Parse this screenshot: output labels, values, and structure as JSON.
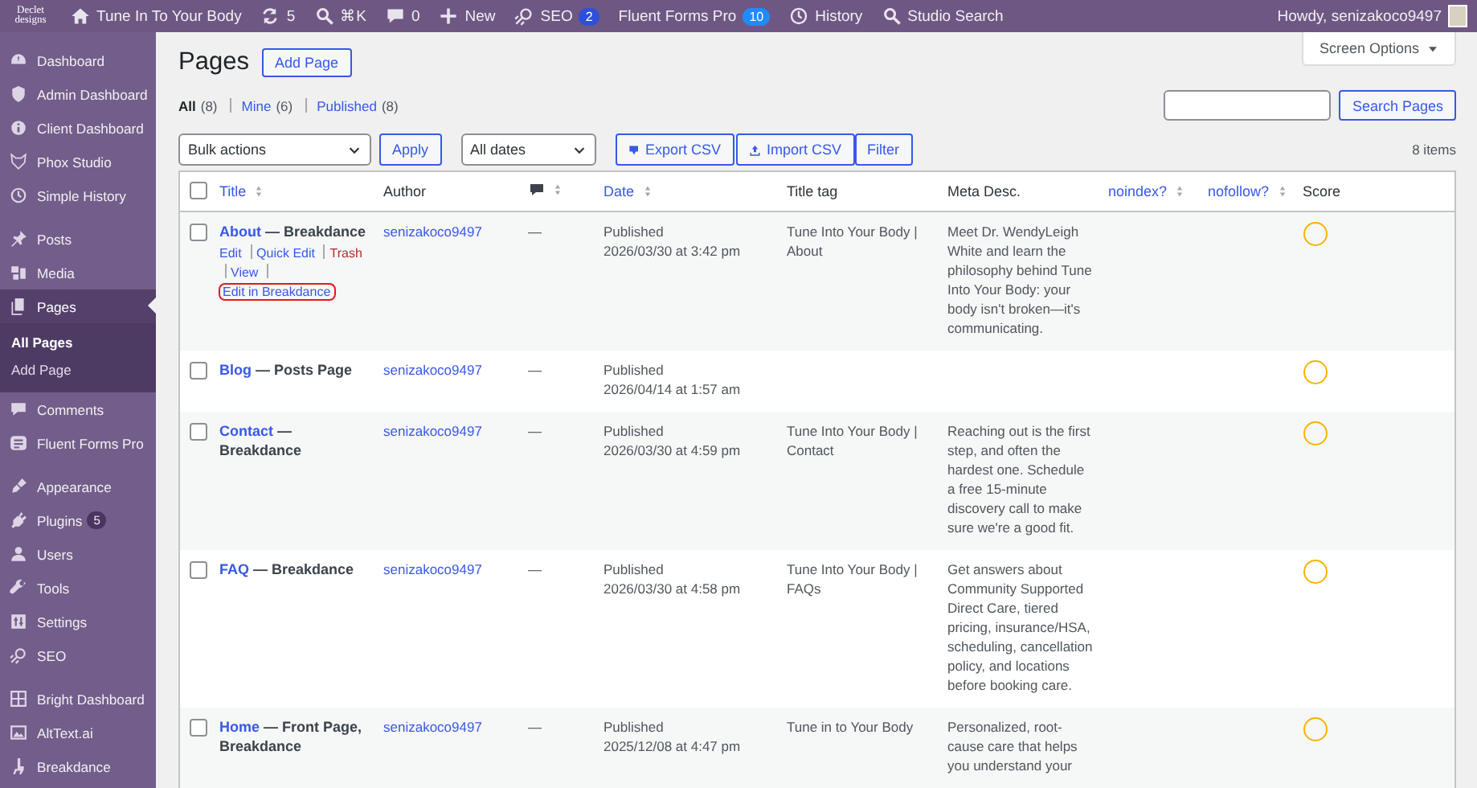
{
  "admin_bar": {
    "logo": [
      "Declet",
      "designs"
    ],
    "items": [
      {
        "kind": "home",
        "label": "Tune In To Your Body"
      },
      {
        "kind": "updates",
        "label": "5"
      },
      {
        "kind": "search",
        "label": "⌘K"
      },
      {
        "kind": "comments",
        "label": "0"
      },
      {
        "kind": "new",
        "label": "New"
      },
      {
        "kind": "seo",
        "label": "SEO",
        "badge": "2",
        "color": "#2f4fd8"
      },
      {
        "kind": "plain",
        "label": "Fluent Forms Pro",
        "badge": "10",
        "color": "#1f8bff"
      },
      {
        "kind": "history",
        "label": "History"
      },
      {
        "kind": "search",
        "label": "Studio Search"
      }
    ],
    "greeting": "Howdy, senizakoco9497"
  },
  "sidebar": {
    "groups": [
      [
        {
          "label": "Dashboard",
          "selected": false
        },
        {
          "label": "Admin Dashboard",
          "selected": false
        },
        {
          "label": "Client Dashboard",
          "selected": false
        },
        {
          "label": "Phox Studio",
          "selected": false
        },
        {
          "label": "Simple History",
          "selected": false
        }
      ],
      [
        {
          "label": "Posts",
          "selected": false
        },
        {
          "label": "Media",
          "selected": false
        },
        {
          "label": "Pages",
          "selected": true,
          "children": [
            {
              "label": "All Pages",
              "selected": true
            },
            {
              "label": "Add Page",
              "selected": false
            }
          ]
        },
        {
          "label": "Comments",
          "selected": false
        },
        {
          "label": "Fluent Forms Pro",
          "selected": false
        }
      ],
      [
        {
          "label": "Appearance",
          "selected": false
        },
        {
          "label": "Plugins",
          "selected": false,
          "badge": "5"
        },
        {
          "label": "Users",
          "selected": false
        },
        {
          "label": "Tools",
          "selected": false
        },
        {
          "label": "Settings",
          "selected": false
        },
        {
          "label": "SEO",
          "selected": false
        }
      ],
      [
        {
          "label": "Bright Dashboard",
          "selected": false
        },
        {
          "label": "AltText.ai",
          "selected": false
        },
        {
          "label": "Breakdance",
          "selected": false
        }
      ]
    ]
  },
  "page": {
    "title": "Pages",
    "add_button": "Add Page",
    "screen_options": "Screen Options",
    "views": [
      {
        "label": "All",
        "count": "(8)",
        "selected": true
      },
      {
        "label": "Mine",
        "count": "(6)",
        "selected": false
      },
      {
        "label": "Published",
        "count": "(8)",
        "selected": false
      }
    ],
    "search_button": "Search Pages",
    "bulk_actions": "Bulk actions",
    "apply": "Apply",
    "dates": "All dates",
    "export": "Export CSV",
    "import": "Import CSV",
    "filter": "Filter",
    "count": "8 items"
  },
  "table": {
    "select_all_checked": false,
    "columns": [
      {
        "kind": "title",
        "label": "Title",
        "link": true,
        "sortable": true
      },
      {
        "kind": "text",
        "label": "Author",
        "link": false,
        "sortable": false
      },
      {
        "kind": "comments",
        "link": false,
        "sortable": true
      },
      {
        "kind": "text",
        "label": "Date",
        "link": true,
        "sortable": true
      },
      {
        "kind": "text",
        "label": "Title tag",
        "link": false,
        "sortable": false
      },
      {
        "kind": "text",
        "label": "Meta Desc.",
        "link": false,
        "sortable": false
      },
      {
        "kind": "text",
        "label": "noindex?",
        "link": true,
        "sortable": true
      },
      {
        "kind": "text",
        "label": "nofollow?",
        "link": true,
        "sortable": true
      },
      {
        "kind": "text",
        "label": "Score",
        "link": false,
        "sortable": false
      }
    ],
    "rows": [
      {
        "checked": false,
        "title": "About",
        "state": "— Breakdance",
        "actions": [
          {
            "label": "Edit",
            "kind": "link",
            "outlined": false
          },
          {
            "label": "Quick Edit",
            "kind": "link",
            "outlined": false
          },
          {
            "label": "Trash",
            "kind": "delete",
            "outlined": false
          },
          {
            "label": "View",
            "kind": "link",
            "outlined": false
          },
          {
            "label": "Edit in Breakdance",
            "kind": "link",
            "outlined": true
          }
        ],
        "author": "senizakoco9497",
        "comments": "—",
        "status": "Published",
        "date": "2026/03/30 at 3:42 pm",
        "title_tag": "Tune Into Your Body | About",
        "meta": "Meet Dr. WendyLeigh White and learn the philosophy behind Tune Into Your Body: your body isn't broken—it's communicating."
      },
      {
        "checked": false,
        "title": "Blog",
        "state": "— Posts Page",
        "author": "senizakoco9497",
        "comments": "—",
        "status": "Published",
        "date": "2026/04/14 at 1:57 am"
      },
      {
        "checked": false,
        "title": "Contact",
        "state": "— Breakdance",
        "author": "senizakoco9497",
        "comments": "—",
        "status": "Published",
        "date": "2026/03/30 at 4:59 pm",
        "title_tag": "Tune Into Your Body | Contact",
        "meta": "Reaching out is the first step, and often the hardest one. Schedule a free 15-minute discovery call to make sure we're a good fit."
      },
      {
        "checked": false,
        "title": "FAQ",
        "state": "— Breakdance",
        "author": "senizakoco9497",
        "comments": "—",
        "status": "Published",
        "date": "2026/03/30 at 4:58 pm",
        "title_tag": "Tune Into Your Body | FAQs",
        "meta": "Get answers about Community Supported Direct Care, tiered pricing, insurance/HSA, scheduling, cancellation policy, and locations before booking care."
      },
      {
        "checked": false,
        "title": "Home",
        "state": "— Front Page, Breakdance",
        "author": "senizakoco9497",
        "comments": "—",
        "status": "Published",
        "date": "2025/12/08 at 4:47 pm",
        "title_tag": "Tune in to Your Body",
        "meta": "Personalized, root-cause care that helps you understand your"
      }
    ]
  }
}
